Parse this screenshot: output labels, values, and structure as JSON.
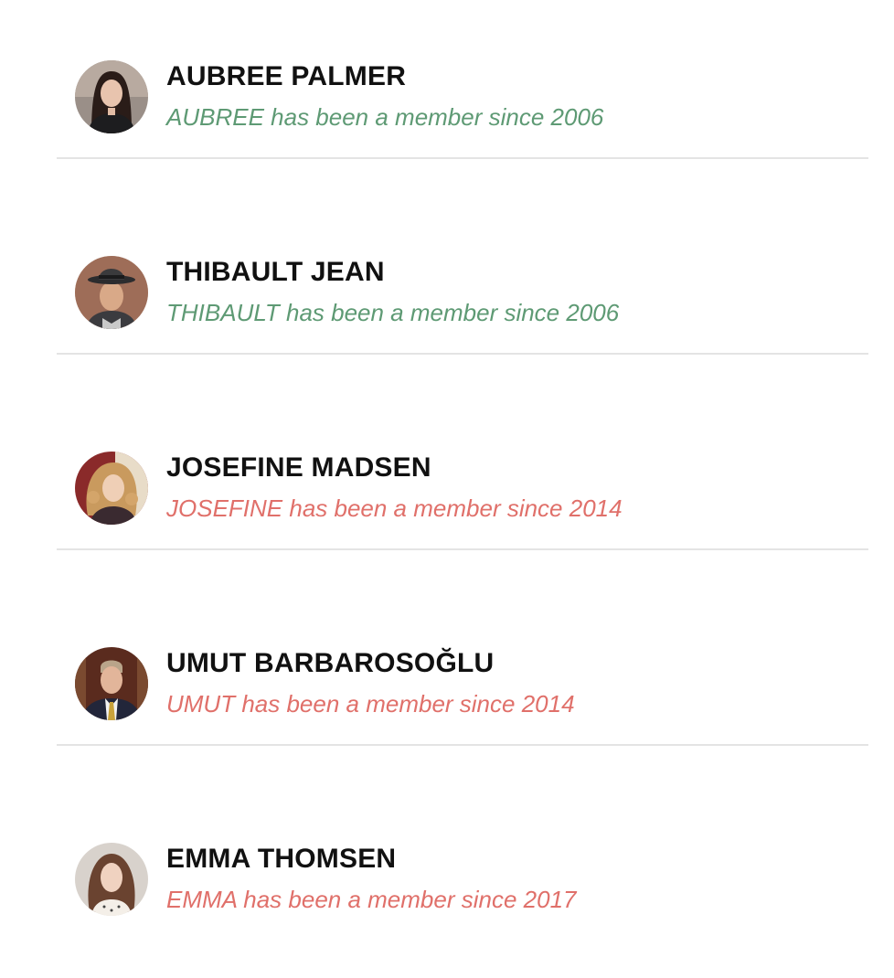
{
  "colors": {
    "veteran_text": "#5e9a74",
    "recent_text": "#e0706a",
    "divider": "#e4e4e4"
  },
  "members": [
    {
      "name": "AUBREE PALMER",
      "since": "AUBREE has been a member since 2006",
      "status_color": "green",
      "avatar": "woman-dark-hair-photo"
    },
    {
      "name": "THIBAULT JEAN",
      "since": "THIBAULT has been a member since 2006",
      "status_color": "green",
      "avatar": "man-fedora-hat-photo"
    },
    {
      "name": "JOSEFINE MADSEN",
      "since": "JOSEFINE has been a member since 2014",
      "status_color": "red",
      "avatar": "woman-curly-blonde-hair-photo"
    },
    {
      "name": "UMUT BARBAROSOĞLU",
      "since": "UMUT has been a member since 2014",
      "status_color": "red",
      "avatar": "man-suit-tie-photo"
    },
    {
      "name": "EMMA THOMSEN",
      "since": "EMMA has been a member since 2017",
      "status_color": "red",
      "avatar": "woman-brown-hair-photo"
    }
  ]
}
